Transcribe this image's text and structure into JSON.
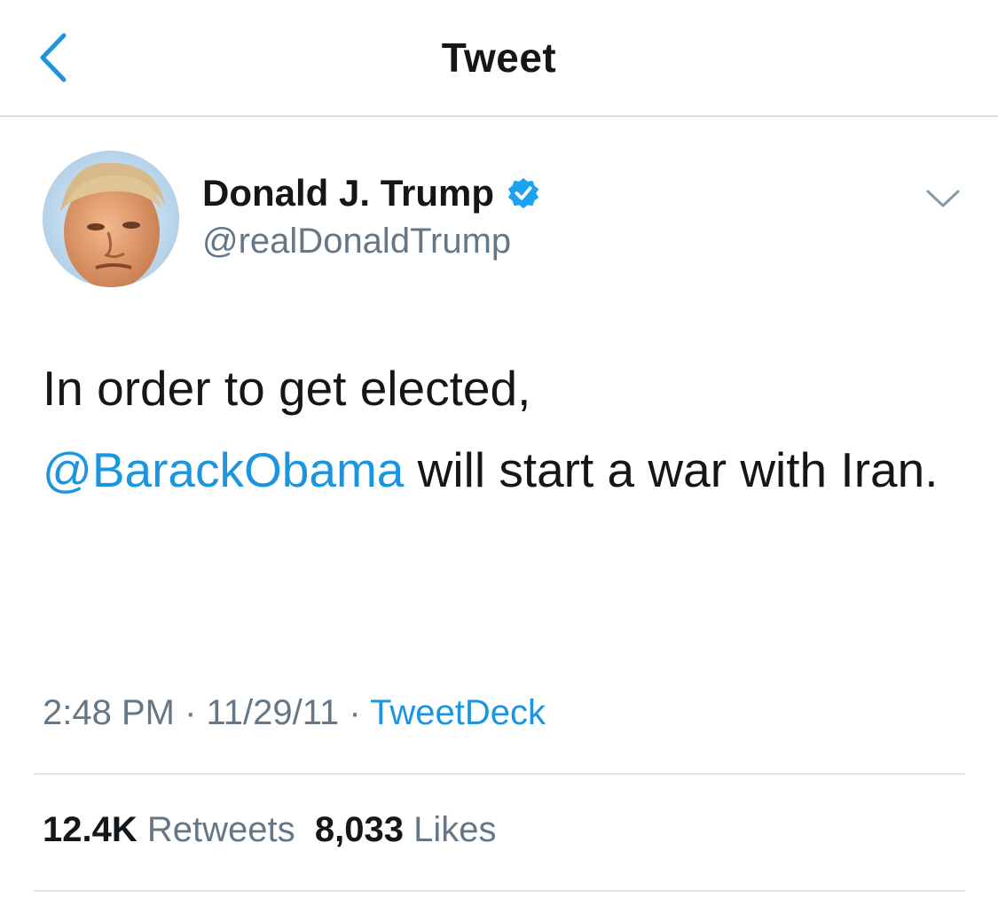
{
  "header": {
    "title": "Tweet"
  },
  "author": {
    "display_name": "Donald J. Trump",
    "handle": "@realDonaldTrump",
    "verified": true
  },
  "tweet": {
    "text_before": "In order to get elected,",
    "mention": "@BarackObama",
    "text_after": " will start a war with Iran."
  },
  "meta": {
    "time": "2:48 PM",
    "separator": " · ",
    "date": "11/29/11",
    "source": "TweetDeck"
  },
  "stats": {
    "retweets_count": "12.4K",
    "retweets_label": "Retweets",
    "likes_count": "8,033",
    "likes_label": "Likes"
  },
  "colors": {
    "accent": "#1b95e0",
    "secondary_text": "#657786",
    "primary_text": "#14171a",
    "verified_badge": "#1da1f2"
  },
  "icons": {
    "back": "chevron-left-icon",
    "verified": "verified-badge-icon",
    "more": "chevron-down-icon"
  }
}
